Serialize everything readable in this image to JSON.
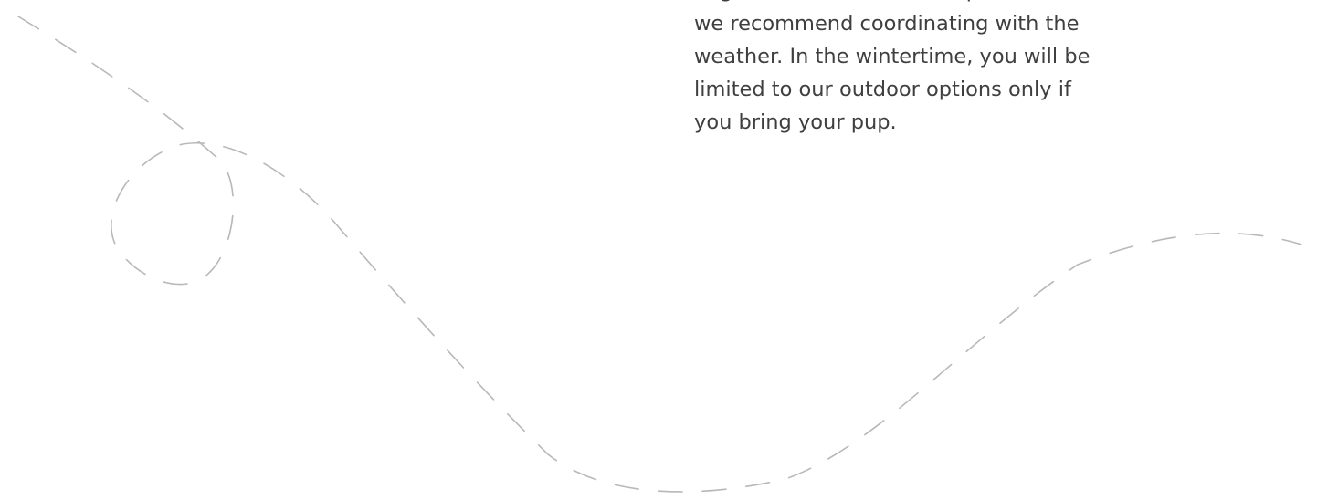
{
  "content": {
    "paragraph_lines": [
      "dogs on seasonal outdoor patios, so",
      "we recommend coordinating with the",
      "weather. In the wintertime, you will be",
      "limited to our outdoor options only if",
      "you bring your pup."
    ]
  },
  "decoration": {
    "line_color": "#b8b8b8",
    "text_color": "#3f3f3f",
    "background_color": "#ffffff"
  }
}
